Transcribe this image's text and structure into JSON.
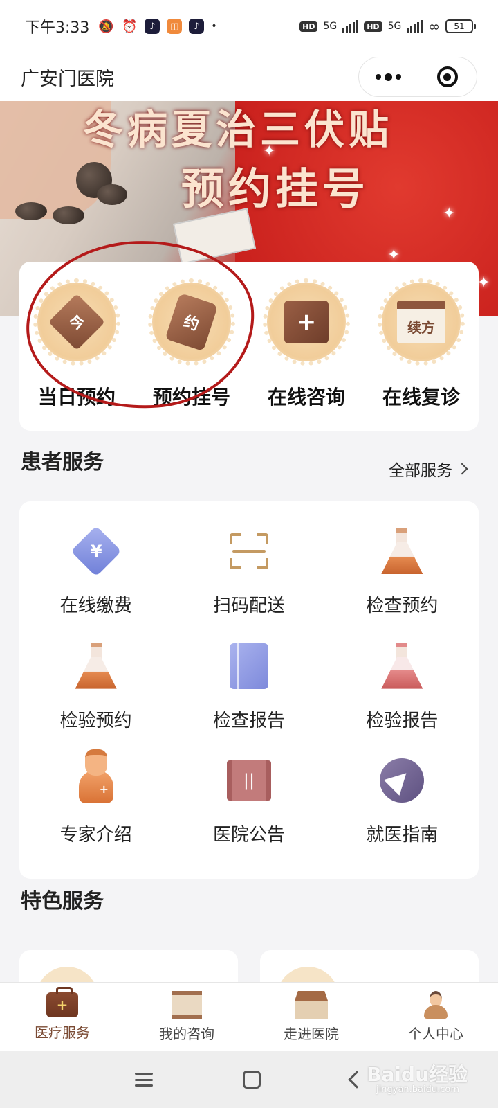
{
  "status_bar": {
    "time": "下午3:33",
    "battery": "51",
    "network_1": "5G",
    "network_2": "5G",
    "hd_1": "HD",
    "hd_2": "HD",
    "icons": [
      "mute-icon",
      "alarm-icon",
      "douyin-app-icon",
      "mi-app-icon",
      "douyin-app-icon"
    ]
  },
  "header": {
    "title": "广安门医院"
  },
  "banner": {
    "line1": "冬病夏治三伏贴",
    "line2": "预约挂号"
  },
  "quick_actions": [
    {
      "label": "当日预约",
      "glyph": "今"
    },
    {
      "label": "预约挂号",
      "glyph": "约"
    },
    {
      "label": "在线咨询",
      "glyph": "+"
    },
    {
      "label": "在线复诊",
      "glyph": "续方"
    }
  ],
  "patient_services": {
    "title": "患者服务",
    "more_label": "全部服务",
    "items": [
      {
        "label": "在线缴费",
        "icon": "payment-icon",
        "glyph": "¥"
      },
      {
        "label": "扫码配送",
        "icon": "scan-icon"
      },
      {
        "label": "检查预约",
        "icon": "flask-icon"
      },
      {
        "label": "检验预约",
        "icon": "flask-icon"
      },
      {
        "label": "检查报告",
        "icon": "report-book-icon"
      },
      {
        "label": "检验报告",
        "icon": "flask-icon"
      },
      {
        "label": "专家介绍",
        "icon": "doctor-icon",
        "glyph": "+"
      },
      {
        "label": "医院公告",
        "icon": "notice-scroll-icon",
        "glyph": "||"
      },
      {
        "label": "就医指南",
        "icon": "navigation-icon"
      }
    ]
  },
  "featured": {
    "title": "特色服务"
  },
  "tabbar": {
    "active_index": 0,
    "items": [
      {
        "label": "医疗服务",
        "icon": "medical-case-icon",
        "glyph": "+"
      },
      {
        "label": "我的咨询",
        "icon": "scroll-icon"
      },
      {
        "label": "走进医院",
        "icon": "hospital-building-icon"
      },
      {
        "label": "个人中心",
        "icon": "person-icon"
      }
    ]
  },
  "watermark": {
    "text": "Baidu经验",
    "sub": "jingyan.baidu.com"
  },
  "colors": {
    "accent_brown": "#7a4a33",
    "banner_red": "#c81f1c",
    "annotation_red": "#b41a1a"
  }
}
